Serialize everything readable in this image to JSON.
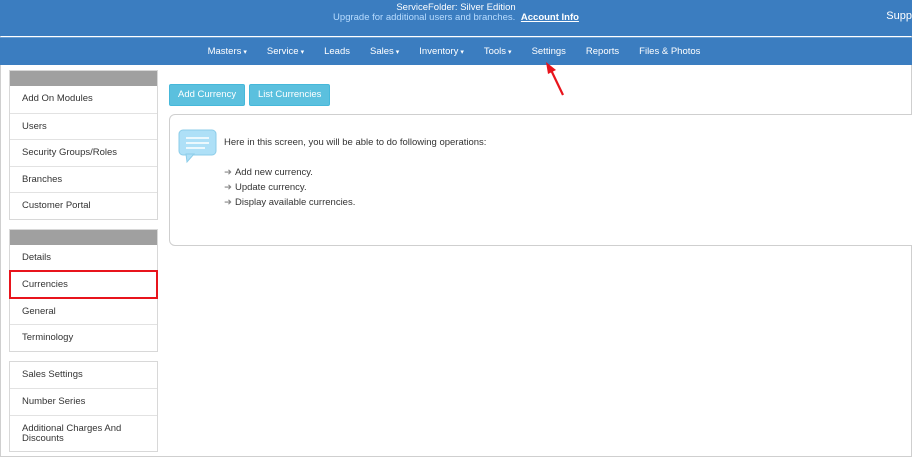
{
  "banner": {
    "title": "ServiceFolder: Silver Edition",
    "upgrade_text": "Upgrade for additional users and branches.",
    "account_link": "Account Info",
    "support_partial": "Supp"
  },
  "nav": {
    "items": [
      {
        "label": "Masters",
        "has_caret": true
      },
      {
        "label": "Service",
        "has_caret": true
      },
      {
        "label": "Leads",
        "has_caret": false
      },
      {
        "label": "Sales",
        "has_caret": true
      },
      {
        "label": "Inventory",
        "has_caret": true
      },
      {
        "label": "Tools",
        "has_caret": true
      },
      {
        "label": "Settings",
        "has_caret": false
      },
      {
        "label": "Reports",
        "has_caret": false
      },
      {
        "label": "Files & Photos",
        "has_caret": false
      }
    ],
    "caret_glyph": "▾"
  },
  "sidebar": {
    "group1": [
      "Add On Modules",
      "Users",
      "Security Groups/Roles",
      "Branches",
      "Customer Portal"
    ],
    "group2": [
      "Details",
      "Currencies",
      "General",
      "Terminology"
    ],
    "group3": [
      "Sales Settings",
      "Number Series",
      "Additional Charges And Discounts"
    ],
    "highlighted": "Currencies"
  },
  "actions": {
    "add_currency": "Add Currency",
    "list_currencies": "List Currencies"
  },
  "info": {
    "intro": "Here in this screen, you will be able to do following operations:",
    "arrow_glyph": "➜",
    "operations": [
      "Add new currency.",
      "Update currency.",
      "Display available currencies."
    ]
  },
  "colors": {
    "header_bg": "#3b7dc0",
    "button_bg": "#5bc0de",
    "highlight_border": "#e8141c",
    "annotation_arrow": "#e8141c"
  }
}
